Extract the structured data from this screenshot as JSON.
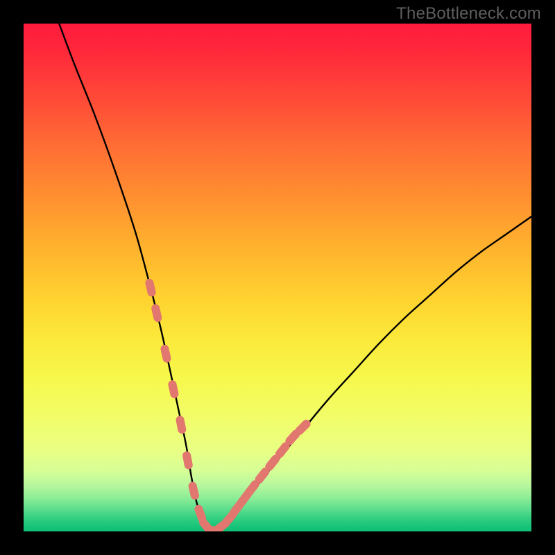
{
  "watermark": "TheBottleneck.com",
  "colors": {
    "frame": "#000000",
    "curve": "#000000",
    "marker_fill": "#e1776e",
    "marker_stroke": "#e1776e",
    "gradient_top": "#ff1a3e",
    "gradient_bottom": "#0fc076"
  },
  "chart_data": {
    "type": "line",
    "title": "",
    "xlabel": "",
    "ylabel": "",
    "xlim": [
      0,
      100
    ],
    "ylim": [
      0,
      100
    ],
    "grid": false,
    "legend": false,
    "series": [
      {
        "name": "bottleneck-curve",
        "x": [
          7,
          10,
          14,
          18,
          22,
          25,
          27,
          29,
          30.5,
          32,
          33,
          34,
          35,
          36,
          37,
          38,
          40,
          43,
          46,
          50,
          55,
          60,
          65,
          70,
          75,
          80,
          85,
          90,
          95,
          100
        ],
        "y": [
          100,
          92,
          82,
          71,
          59,
          48,
          40,
          31,
          24,
          17,
          11,
          6,
          3,
          1,
          0,
          0.3,
          1.8,
          5,
          9,
          14,
          20,
          26,
          31.5,
          37,
          42,
          46.5,
          51,
          55,
          58.5,
          62
        ]
      }
    ],
    "markers": {
      "name": "highlighted-points",
      "note": "salmon rounded-dash markers clustered near the valley along both sides of the curve",
      "points": [
        {
          "x": 25,
          "y": 48
        },
        {
          "x": 26.2,
          "y": 43
        },
        {
          "x": 28,
          "y": 35
        },
        {
          "x": 29.5,
          "y": 28
        },
        {
          "x": 31,
          "y": 21
        },
        {
          "x": 32.3,
          "y": 14
        },
        {
          "x": 33.5,
          "y": 8
        },
        {
          "x": 34.8,
          "y": 3.5
        },
        {
          "x": 36,
          "y": 1
        },
        {
          "x": 37.5,
          "y": 0.2
        },
        {
          "x": 39,
          "y": 1
        },
        {
          "x": 40.5,
          "y": 2.5
        },
        {
          "x": 42,
          "y": 4.5
        },
        {
          "x": 43.5,
          "y": 6.5
        },
        {
          "x": 45,
          "y": 8.5
        },
        {
          "x": 47,
          "y": 11
        },
        {
          "x": 49,
          "y": 13.5
        },
        {
          "x": 51,
          "y": 16
        },
        {
          "x": 53,
          "y": 18.5
        },
        {
          "x": 55,
          "y": 20.5
        }
      ]
    }
  }
}
